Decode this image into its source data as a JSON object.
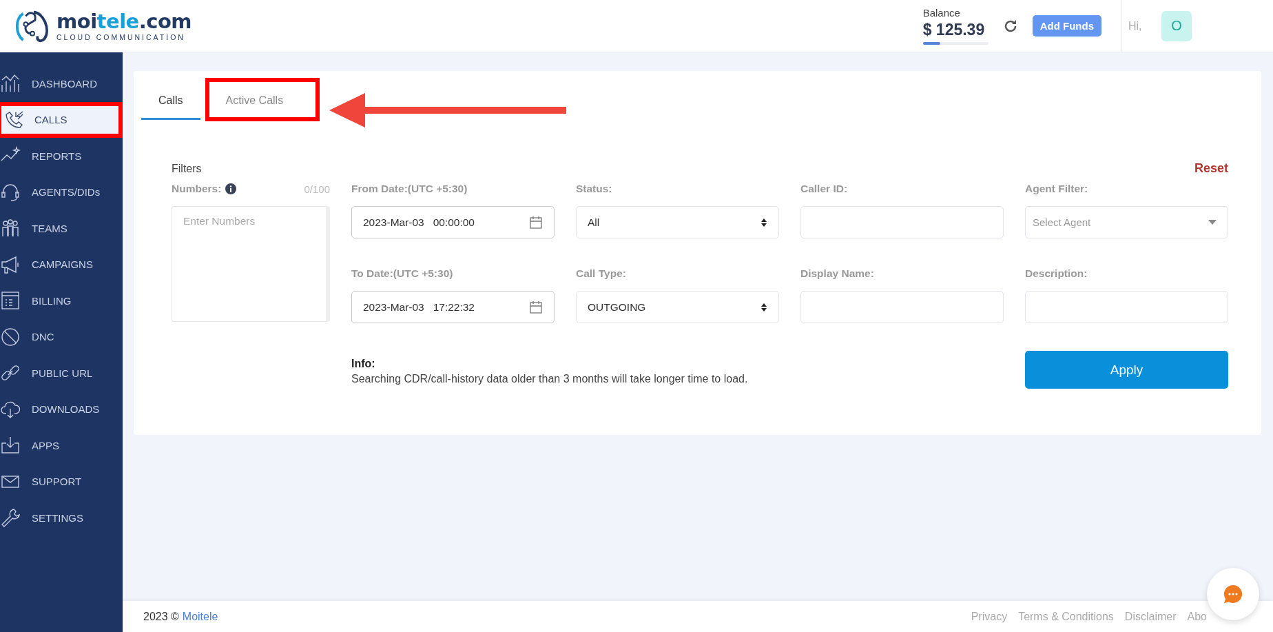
{
  "header": {
    "logo": {
      "wordmark": [
        {
          "text": "moi",
          "accent": false
        },
        {
          "text": "tele",
          "accent": true
        },
        {
          "text": ".com",
          "accent": false
        }
      ],
      "tagline": "CLOUD COMMUNICATION"
    },
    "balance": {
      "label": "Balance",
      "amount": "$ 125.39",
      "level": 0.27
    },
    "add_funds": "Add Funds",
    "greeting": "Hi,",
    "avatar": "O"
  },
  "sidebar": {
    "items": [
      {
        "label": "DASHBOARD",
        "selected": false,
        "highlighted": false
      },
      {
        "label": "CALLS",
        "selected": true,
        "highlighted": true
      },
      {
        "label": "REPORTS",
        "selected": false,
        "highlighted": false
      },
      {
        "label": "AGENTS/DIDs",
        "selected": false,
        "highlighted": false
      },
      {
        "label": "TEAMS",
        "selected": false,
        "highlighted": false
      },
      {
        "label": "CAMPAIGNS",
        "selected": false,
        "highlighted": false
      },
      {
        "label": "BILLING",
        "selected": false,
        "highlighted": false
      },
      {
        "label": "DNC",
        "selected": false,
        "highlighted": false
      },
      {
        "label": "PUBLIC URL",
        "selected": false,
        "highlighted": false
      },
      {
        "label": "DOWNLOADS",
        "selected": false,
        "highlighted": false
      },
      {
        "label": "APPS",
        "selected": false,
        "highlighted": false
      },
      {
        "label": "SUPPORT",
        "selected": false,
        "highlighted": false
      },
      {
        "label": "SETTINGS",
        "selected": false,
        "highlighted": false
      }
    ]
  },
  "tabs": [
    {
      "label": "Calls",
      "selected": true,
      "highlighted": false,
      "pointed": false
    },
    {
      "label": "Active Calls",
      "selected": false,
      "highlighted": true,
      "pointed": true
    }
  ],
  "filters": {
    "title": "Filters",
    "reset": "Reset",
    "numbers": {
      "label": "Numbers:",
      "counter": "0/100",
      "placeholder": "Enter Numbers"
    },
    "fields": [
      {
        "kind": "date",
        "label": "From Date:(UTC +5:30)",
        "value": "2023-Mar-03   00:00:00"
      },
      {
        "kind": "select",
        "label": "Status:",
        "value": "All"
      },
      {
        "kind": "text",
        "label": "Caller ID:"
      },
      {
        "kind": "dropdown",
        "label": "Agent Filter:",
        "placeholder": "Select Agent"
      },
      {
        "kind": "date",
        "label": "To Date:(UTC +5:30)",
        "value": "2023-Mar-03   17:22:32"
      },
      {
        "kind": "select",
        "label": "Call Type:",
        "value": "OUTGOING"
      },
      {
        "kind": "text",
        "label": "Display Name:"
      },
      {
        "kind": "text",
        "label": "Description:"
      }
    ],
    "info": {
      "title": "Info:",
      "text": "Searching CDR/call-history data older than 3 months will take longer time to load."
    },
    "apply": "Apply"
  },
  "footer": {
    "year": "2023 ©",
    "brand": "Moitele",
    "links": [
      "Privacy",
      "Terms & Conditions",
      "Disclaimer",
      "Abo"
    ]
  }
}
